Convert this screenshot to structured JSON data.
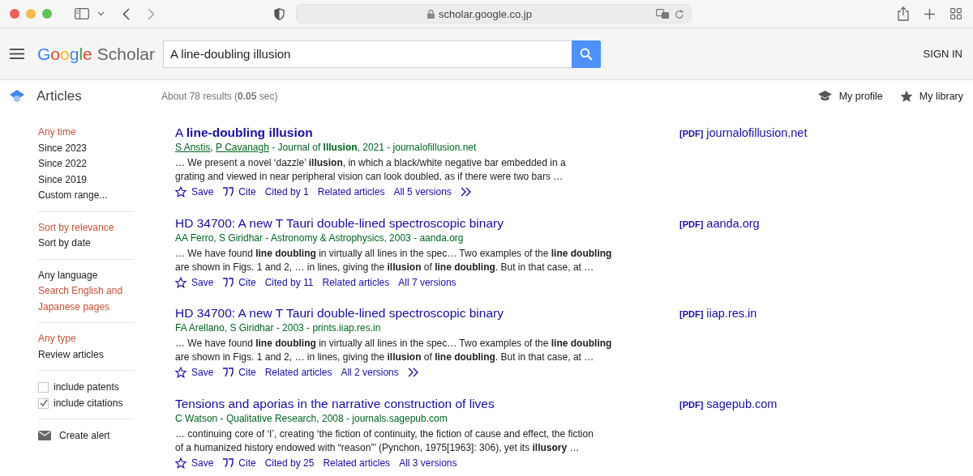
{
  "browser": {
    "url": "scholar.google.co.jp"
  },
  "header": {
    "logo": {
      "brand": "Google",
      "product": "Scholar"
    },
    "search": {
      "value": "A line-doubling illusion"
    },
    "sign_in": "SIGN IN"
  },
  "subheader": {
    "section": "Articles",
    "summary": "About 78 results (**0.05** sec)",
    "links": [
      {
        "kind": "profile",
        "label": "My profile"
      },
      {
        "kind": "library",
        "label": "My library"
      }
    ]
  },
  "sidebar": {
    "groups": [
      {
        "kind": "options",
        "items": [
          {
            "label": "Any time",
            "selected": true
          },
          {
            "label": "Since 2023",
            "selected": false
          },
          {
            "label": "Since 2022",
            "selected": false
          },
          {
            "label": "Since 2019",
            "selected": false
          },
          {
            "label": "Custom range...",
            "selected": false
          }
        ]
      },
      {
        "kind": "options",
        "items": [
          {
            "label": "Sort by relevance",
            "selected": true
          },
          {
            "label": "Sort by date",
            "selected": false
          }
        ]
      },
      {
        "kind": "options",
        "items": [
          {
            "label": "Any language",
            "selected": false
          },
          {
            "label": "Search English and Japanese pages",
            "selected": true
          }
        ]
      },
      {
        "kind": "options",
        "items": [
          {
            "label": "Any type",
            "selected": true
          },
          {
            "label": "Review articles",
            "selected": false
          }
        ]
      },
      {
        "kind": "checks",
        "items": [
          {
            "label": "include patents",
            "checked": false
          },
          {
            "label": "include citations",
            "checked": true
          }
        ]
      },
      {
        "kind": "alert",
        "items": [
          {
            "label": "Create alert"
          }
        ]
      }
    ]
  },
  "results": [
    {
      "title": "A **line-doubling illusion**",
      "meta": [
        {
          "text": "S Anstis",
          "linked": true
        },
        {
          "text": ", ",
          "linked": false
        },
        {
          "text": "P Cavanagh",
          "linked": true
        },
        {
          "text": " - Journal of **Illusion**, 2021 - journalofillusion.net",
          "linked": false
        }
      ],
      "snippet": [
        "… We present a novel ‘dazzle’ **illusion**, in which a black/white negative bar embedded in a",
        "grating and viewed in near peripheral vision can look doubled, as if there were two bars …"
      ],
      "actions": [
        {
          "kind": "save",
          "label": "Save"
        },
        {
          "kind": "cite",
          "label": "Cite"
        },
        {
          "kind": "link",
          "label": "Cited by 1"
        },
        {
          "kind": "link",
          "label": "Related articles"
        },
        {
          "kind": "link",
          "label": "All 5 versions"
        },
        {
          "kind": "more"
        }
      ],
      "pdf": {
        "tag": "[PDF]",
        "site": "journalofillusion.net"
      }
    },
    {
      "title": "HD 34700: A new T Tauri double-lined spectroscopic binary",
      "meta": [
        {
          "text": "AA Ferro, S Giridhar - Astronomy & Astrophysics, 2003 - aanda.org",
          "linked": false
        }
      ],
      "snippet": [
        "… We have found **line doubling** in virtually all lines in the spec… Two examples of the **line doubling**",
        "are shown in Figs. 1 and 2, … in lines, giving the **illusion** of **line doubling**. But in that case, at …"
      ],
      "actions": [
        {
          "kind": "save",
          "label": "Save"
        },
        {
          "kind": "cite",
          "label": "Cite"
        },
        {
          "kind": "link",
          "label": "Cited by 11"
        },
        {
          "kind": "link",
          "label": "Related articles"
        },
        {
          "kind": "link",
          "label": "All 7 versions"
        }
      ],
      "pdf": {
        "tag": "[PDF]",
        "site": "aanda.org"
      }
    },
    {
      "title": "HD 34700: A new T Tauri double-lined spectroscopic binary",
      "meta": [
        {
          "text": "FA Arellano, S Giridhar - 2003 - prints.iiap.res.in",
          "linked": false
        }
      ],
      "snippet": [
        "… We have found **line doubling** in virtually all lines in the spec… Two examples of the **line doubling**",
        "are shown in Figs. 1 and 2, … in lines, giving the **illusion** of **line doubling**. But in that case, at …"
      ],
      "actions": [
        {
          "kind": "save",
          "label": "Save"
        },
        {
          "kind": "cite",
          "label": "Cite"
        },
        {
          "kind": "link",
          "label": "Related articles"
        },
        {
          "kind": "link",
          "label": "All 2 versions"
        },
        {
          "kind": "more"
        }
      ],
      "pdf": {
        "tag": "[PDF]",
        "site": "iiap.res.in"
      }
    },
    {
      "title": "Tensions and aporias in the narrative construction of lives",
      "meta": [
        {
          "text": "C Watson - Qualitative Research, 2008 - journals.sagepub.com",
          "linked": false
        }
      ],
      "snippet": [
        "… continuing core of ‘I’, creating ‘the fiction of continuity, the fiction of cause and effect, the fiction",
        "of a humanized history endowed with “reason”’ (Pynchon, 1975[1963]: 306), yet its **illusory** …"
      ],
      "actions": [
        {
          "kind": "save",
          "label": "Save"
        },
        {
          "kind": "cite",
          "label": "Cite"
        },
        {
          "kind": "link",
          "label": "Cited by 25"
        },
        {
          "kind": "link",
          "label": "Related articles"
        },
        {
          "kind": "link",
          "label": "All 3 versions"
        }
      ],
      "pdf": {
        "tag": "[PDF]",
        "site": "sagepub.com"
      }
    }
  ]
}
